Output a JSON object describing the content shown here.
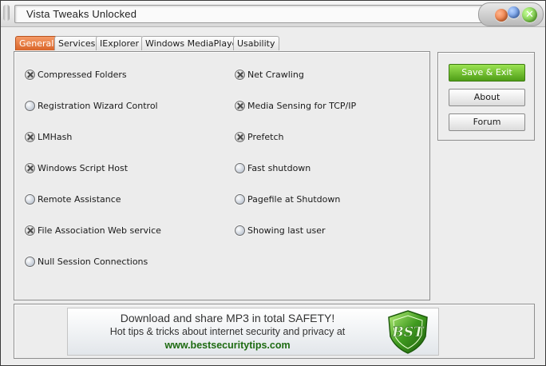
{
  "window": {
    "title": "Vista Tweaks Unlocked",
    "controls": {
      "close_glyph": "✕"
    }
  },
  "tabs": [
    {
      "label": "General",
      "active": true
    },
    {
      "label": "Services",
      "active": false
    },
    {
      "label": "IExplorer",
      "active": false
    },
    {
      "label": "Windows MediaPlayer",
      "active": false
    },
    {
      "label": "Usability",
      "active": false
    }
  ],
  "options_left": [
    {
      "label": "Compressed Folders",
      "checked": true
    },
    {
      "label": "Registration Wizard Control",
      "checked": false
    },
    {
      "label": "LMHash",
      "checked": true
    },
    {
      "label": "Windows Script Host",
      "checked": true
    },
    {
      "label": "Remote Assistance",
      "checked": false
    },
    {
      "label": "File Association Web service",
      "checked": true
    },
    {
      "label": "Null Session Connections",
      "checked": false
    }
  ],
  "options_right": [
    {
      "label": "Net Crawling",
      "checked": true
    },
    {
      "label": "Media Sensing for TCP/IP",
      "checked": true
    },
    {
      "label": "Prefetch",
      "checked": true
    },
    {
      "label": "Fast shutdown",
      "checked": false
    },
    {
      "label": "Pagefile at Shutdown",
      "checked": false
    },
    {
      "label": "Showing last user",
      "checked": false
    }
  ],
  "buttons": {
    "save_exit": "Save & Exit",
    "about": "About",
    "forum": "Forum"
  },
  "banner": {
    "line1": "Download and share MP3  in total SAFETY!",
    "line2": "Hot tips & tricks about internet security and privacy at",
    "line3": "www.bestsecuritytips.com",
    "logo_text": "BST"
  },
  "colors": {
    "active_tab": "#e07030",
    "primary_button": "#6cc02a",
    "banner_link": "#1e6b12"
  }
}
